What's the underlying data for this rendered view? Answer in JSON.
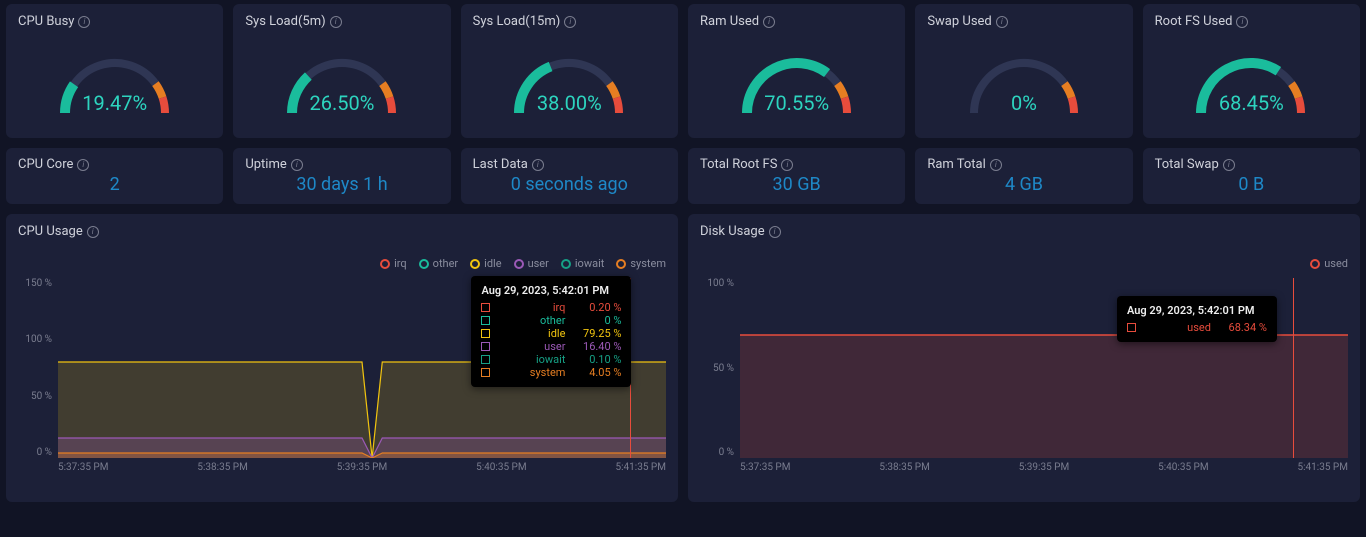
{
  "gauges": [
    {
      "title": "CPU Busy",
      "value": 19.47,
      "display": "19.47%"
    },
    {
      "title": "Sys Load(5m)",
      "value": 26.5,
      "display": "26.50%"
    },
    {
      "title": "Sys Load(15m)",
      "value": 38.0,
      "display": "38.00%"
    },
    {
      "title": "Ram Used",
      "value": 70.55,
      "display": "70.55%"
    },
    {
      "title": "Swap Used",
      "value": 0,
      "display": "0%"
    },
    {
      "title": "Root FS Used",
      "value": 68.45,
      "display": "68.45%"
    }
  ],
  "stats": [
    {
      "title": "CPU Core",
      "value": "2"
    },
    {
      "title": "Uptime",
      "value": "30 days 1 h"
    },
    {
      "title": "Last Data",
      "value": "0 seconds ago"
    },
    {
      "title": "Total Root FS",
      "value": "30 GB"
    },
    {
      "title": "Ram Total",
      "value": "4 GB"
    },
    {
      "title": "Total Swap",
      "value": "0 B"
    }
  ],
  "cpu_chart": {
    "title": "CPU Usage",
    "legend": [
      {
        "name": "irq",
        "color": "#e74c3c"
      },
      {
        "name": "other",
        "color": "#1abc9c"
      },
      {
        "name": "idle",
        "color": "#f1c40f"
      },
      {
        "name": "user",
        "color": "#9b59b6"
      },
      {
        "name": "iowait",
        "color": "#16a085"
      },
      {
        "name": "system",
        "color": "#e67e22"
      }
    ],
    "yticks": [
      "150 %",
      "100 %",
      "50 %",
      "0 %"
    ],
    "xticks": [
      "5:37:35 PM",
      "5:38:35 PM",
      "5:39:35 PM",
      "5:40:35 PM",
      "5:41:35 PM"
    ],
    "tooltip": {
      "time": "Aug 29, 2023, 5:42:01 PM",
      "rows": [
        {
          "label": "irq",
          "value": "0.20 %",
          "color": "#e74c3c"
        },
        {
          "label": "other",
          "value": "0 %",
          "color": "#1abc9c"
        },
        {
          "label": "idle",
          "value": "79.25 %",
          "color": "#f1c40f"
        },
        {
          "label": "user",
          "value": "16.40 %",
          "color": "#9b59b6"
        },
        {
          "label": "iowait",
          "value": "0.10 %",
          "color": "#16a085"
        },
        {
          "label": "system",
          "value": "4.05 %",
          "color": "#e67e22"
        }
      ]
    }
  },
  "disk_chart": {
    "title": "Disk Usage",
    "legend": [
      {
        "name": "used",
        "color": "#e74c3c"
      }
    ],
    "yticks": [
      "100 %",
      "50 %",
      "0 %"
    ],
    "xticks": [
      "5:37:35 PM",
      "5:38:35 PM",
      "5:39:35 PM",
      "5:40:35 PM",
      "5:41:35 PM"
    ],
    "tooltip": {
      "time": "Aug 29, 2023, 5:42:01 PM",
      "rows": [
        {
          "label": "used",
          "value": "68.34 %",
          "color": "#e74c3c"
        }
      ]
    }
  },
  "chart_data": [
    {
      "type": "gauge",
      "gauges": [
        {
          "name": "CPU Busy",
          "value": 19.47,
          "min": 0,
          "max": 100,
          "unit": "%"
        },
        {
          "name": "Sys Load(5m)",
          "value": 26.5,
          "min": 0,
          "max": 100,
          "unit": "%"
        },
        {
          "name": "Sys Load(15m)",
          "value": 38.0,
          "min": 0,
          "max": 100,
          "unit": "%"
        },
        {
          "name": "Ram Used",
          "value": 70.55,
          "min": 0,
          "max": 100,
          "unit": "%"
        },
        {
          "name": "Swap Used",
          "value": 0,
          "min": 0,
          "max": 100,
          "unit": "%"
        },
        {
          "name": "Root FS Used",
          "value": 68.45,
          "min": 0,
          "max": 100,
          "unit": "%"
        }
      ],
      "thresholds": [
        {
          "from": 0,
          "to": 80,
          "color": "#1abc9c"
        },
        {
          "from": 80,
          "to": 90,
          "color": "#e67e22"
        },
        {
          "from": 90,
          "to": 100,
          "color": "#e74c3c"
        }
      ]
    },
    {
      "type": "area",
      "title": "CPU Usage",
      "xlabel": "",
      "ylabel": "",
      "ylim": [
        0,
        150
      ],
      "yunit": "%",
      "x": [
        "5:37:35 PM",
        "5:38:35 PM",
        "5:39:35 PM",
        "5:40:35 PM",
        "5:41:35 PM",
        "5:42:01 PM"
      ],
      "series": [
        {
          "name": "irq",
          "color": "#e74c3c",
          "values": [
            0.2,
            0.2,
            0.2,
            0.2,
            0.2,
            0.2
          ]
        },
        {
          "name": "other",
          "color": "#1abc9c",
          "values": [
            0,
            0,
            0,
            0,
            0,
            0
          ]
        },
        {
          "name": "idle",
          "color": "#f1c40f",
          "values": [
            80,
            79,
            0,
            80,
            79,
            79.25
          ]
        },
        {
          "name": "user",
          "color": "#9b59b6",
          "values": [
            15,
            16,
            0,
            17,
            16,
            16.4
          ]
        },
        {
          "name": "iowait",
          "color": "#16a085",
          "values": [
            0.1,
            0.1,
            0.1,
            0.1,
            0.1,
            0.1
          ]
        },
        {
          "name": "system",
          "color": "#e67e22",
          "values": [
            4,
            4,
            0,
            4,
            4,
            4.05
          ]
        }
      ],
      "note": "Gap/drop observed around 5:39:35 PM."
    },
    {
      "type": "area",
      "title": "Disk Usage",
      "xlabel": "",
      "ylabel": "",
      "ylim": [
        0,
        100
      ],
      "yunit": "%",
      "x": [
        "5:37:35 PM",
        "5:38:35 PM",
        "5:39:35 PM",
        "5:40:35 PM",
        "5:41:35 PM",
        "5:42:01 PM"
      ],
      "series": [
        {
          "name": "used",
          "color": "#e74c3c",
          "values": [
            68.3,
            68.3,
            68.3,
            68.3,
            68.3,
            68.34
          ]
        }
      ]
    }
  ]
}
